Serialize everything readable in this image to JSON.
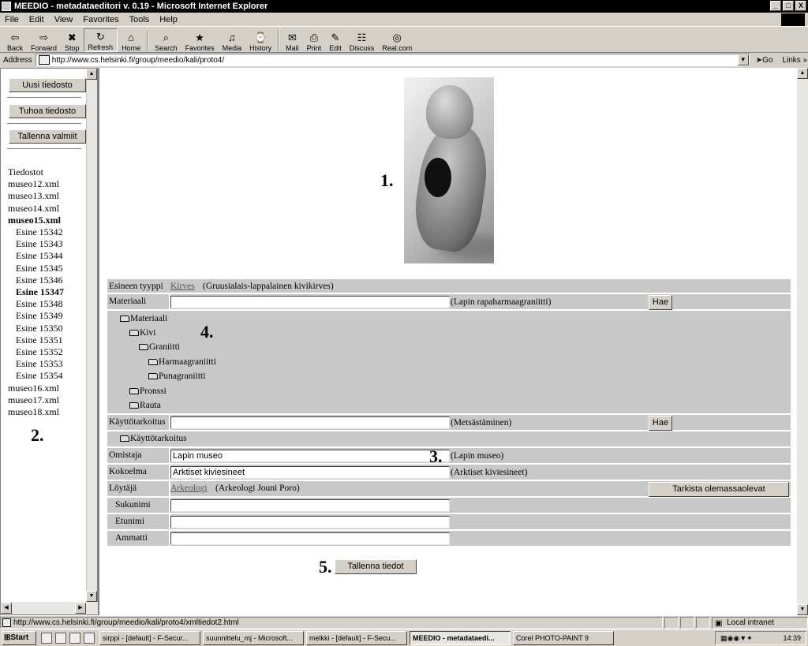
{
  "window": {
    "title": "MEEDIO - metadataeditori v. 0.19 - Microsoft Internet Explorer",
    "controls": [
      "_",
      "□",
      "X"
    ]
  },
  "menu": [
    "File",
    "Edit",
    "View",
    "Favorites",
    "Tools",
    "Help"
  ],
  "toolbar": [
    {
      "label": "Back",
      "icon": "⇦"
    },
    {
      "label": "Forward",
      "icon": "⇨"
    },
    {
      "label": "Stop",
      "icon": "✖"
    },
    {
      "label": "Refresh",
      "icon": "↻"
    },
    {
      "label": "Home",
      "icon": "⌂"
    },
    {
      "label": "Search",
      "icon": "⌕"
    },
    {
      "label": "Favorites",
      "icon": "★"
    },
    {
      "label": "Media",
      "icon": "♫"
    },
    {
      "label": "History",
      "icon": "⌚"
    },
    {
      "label": "Mail",
      "icon": "✉"
    },
    {
      "label": "Print",
      "icon": "⎙"
    },
    {
      "label": "Edit",
      "icon": "✎"
    },
    {
      "label": "Discuss",
      "icon": "☷"
    },
    {
      "label": "Real.com",
      "icon": "◎"
    }
  ],
  "address": {
    "label": "Address",
    "url": "http://www.cs.helsinki.fi/group/meedio/kali/proto4/",
    "go": "Go",
    "links": "Links"
  },
  "left": {
    "buttons": [
      "Uusi tiedosto",
      "Tuhoa tiedosto",
      "Tallenna valmiit"
    ],
    "files_header": "Tiedostot",
    "files_before": [
      "museo12.xml",
      "museo13.xml",
      "museo14.xml"
    ],
    "open_file": "museo15.xml",
    "items": [
      "Esine 15342",
      "Esine 15343",
      "Esine 15344",
      "Esine 15345",
      "Esine 15346",
      "Esine 15347",
      "Esine 15348",
      "Esine 15349",
      "Esine 15350",
      "Esine 15351",
      "Esine 15352",
      "Esine 15353",
      "Esine 15354"
    ],
    "selected_item": "Esine 15347",
    "files_after": [
      "museo16.xml",
      "museo17.xml",
      "museo18.xml"
    ],
    "marker": "2."
  },
  "markers": {
    "photo": "1.",
    "tree": "4.",
    "fields": "3.",
    "save": "5."
  },
  "form": {
    "type_label": "Esineen tyyppi",
    "type_link": "Kirves",
    "type_desc": "(Gruusialais-lappalainen kivikirves)",
    "material_label": "Materiaali",
    "material_value": "",
    "material_hint": "(Lapin rapaharmaagraniitti)",
    "search_button": "Hae",
    "material_tree": [
      "Materiaali",
      "Kivi",
      "Graniitti",
      "Harmaagraniitti",
      "Punagraniitti",
      "Pronssi",
      "Rauta"
    ],
    "purpose_label": "Käyttötarkoitus",
    "purpose_value": "",
    "purpose_hint": "(Metsästäminen)",
    "purpose_tree": [
      "Käyttötarkoitus"
    ],
    "owner_label": "Omistaja",
    "owner_value": "Lapin museo",
    "owner_hint": "(Lapin museo)",
    "collection_label": "Kokoelma",
    "collection_value": "Arktiset kiviesineet",
    "collection_hint": "(Arktiset kiviesineet)",
    "finder_label": "Löytäjä",
    "finder_link": "Arkeologi",
    "finder_desc": "(Arkeologi Jouni Poro)",
    "check_button": "Tarkista olemassaolevat",
    "surname_label": "Sukunimi",
    "firstname_label": "Etunimi",
    "profession_label": "Ammatti",
    "save_button": "Tallenna tiedot"
  },
  "status": {
    "text": "http://www.cs.helsinki.fi/group/meedio/kali/proto4/xmltiedot2.html",
    "zone": "Local intranet"
  },
  "taskbar": {
    "start": "Start",
    "tasks": [
      "sirppi - [default] - F-Secur...",
      "suunnittelu_mj - Microsoft...",
      "melkki - [default] - F-Secu...",
      "MEEDIO - metadataedi...",
      "Corel PHOTO-PAINT 9"
    ],
    "clock": "14:39"
  }
}
